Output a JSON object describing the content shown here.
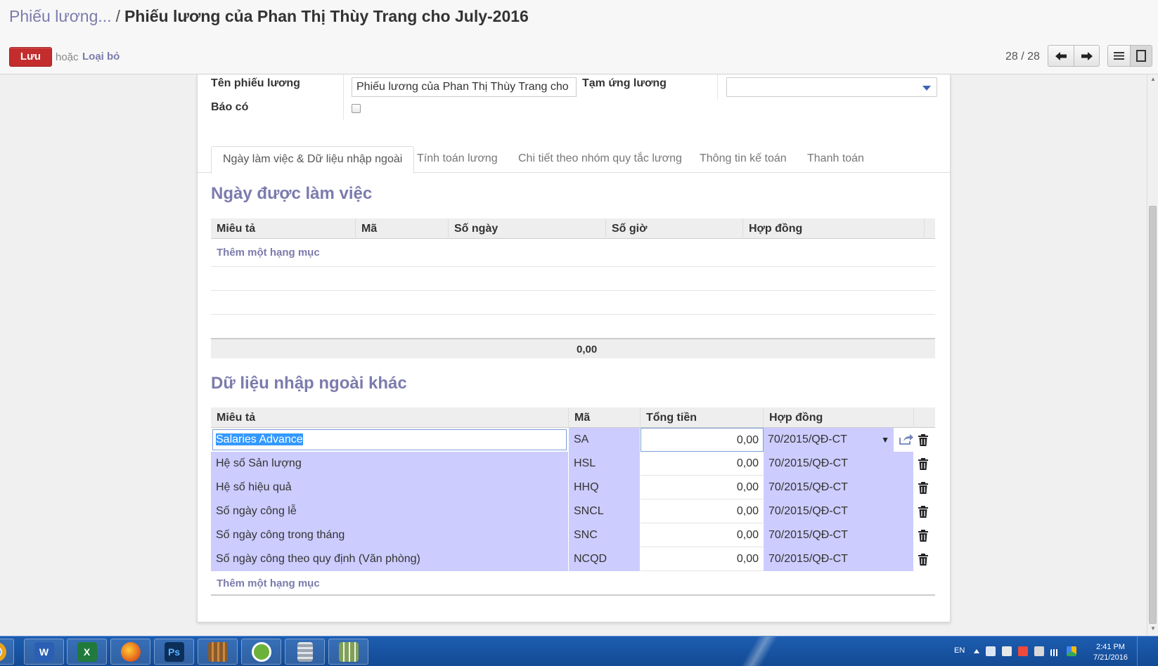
{
  "header": {
    "breadcrumb_parent": "Phiếu lương...",
    "breadcrumb_separator": "/",
    "title": "Phiếu lương của Phan Thị Thùy Trang cho July-2016",
    "save_label": "Lưu",
    "or_label": "hoặc",
    "discard_label": "Loại bỏ",
    "pager": "28 / 28"
  },
  "form": {
    "name_label": "Tên phiếu lương",
    "name_value": "Phiếu lương của Phan Thị Thùy Trang cho",
    "advance_label": "Tạm ứng lương",
    "advance_value": "",
    "credit_note_label": "Báo có"
  },
  "tabs": [
    {
      "label": "Ngày làm việc & Dữ liệu nhập ngoài",
      "active": true
    },
    {
      "label": "Tính toán lương",
      "active": false
    },
    {
      "label": "Chi tiết theo nhóm quy tắc lương",
      "active": false
    },
    {
      "label": "Thông tin kế toán",
      "active": false
    },
    {
      "label": "Thanh toán",
      "active": false
    }
  ],
  "worked_days": {
    "title": "Ngày được làm việc",
    "columns": [
      "Miêu tả",
      "Mã",
      "Số ngày",
      "Số giờ",
      "Hợp đồng"
    ],
    "add_label": "Thêm một hạng mục",
    "total": "0,00"
  },
  "inputs": {
    "title": "Dữ liệu nhập ngoài khác",
    "columns": [
      "Miêu tả",
      "Mã",
      "Tổng tiền",
      "Hợp đồng"
    ],
    "rows": [
      {
        "desc": "Salaries Advance",
        "code": "SA",
        "amount": "0,00",
        "contract": "70/2015/QĐ-CT"
      },
      {
        "desc": "Hệ số Sản lượng",
        "code": "HSL",
        "amount": "0,00",
        "contract": "70/2015/QĐ-CT"
      },
      {
        "desc": "Hệ số hiệu quả",
        "code": "HHQ",
        "amount": "0,00",
        "contract": "70/2015/QĐ-CT"
      },
      {
        "desc": "Số ngày công lễ",
        "code": "SNCL",
        "amount": "0,00",
        "contract": "70/2015/QĐ-CT"
      },
      {
        "desc": "Số ngày công trong tháng",
        "code": "SNC",
        "amount": "0,00",
        "contract": "70/2015/QĐ-CT"
      },
      {
        "desc": "Số ngày công theo quy định (Văn phòng)",
        "code": "NCQD",
        "amount": "0,00",
        "contract": "70/2015/QĐ-CT"
      }
    ],
    "add_label": "Thêm một hạng mục"
  },
  "taskbar": {
    "apps": [
      {
        "icon": "chrome-icon",
        "color": "#e8a41c"
      },
      {
        "icon": "word-icon",
        "label": "W",
        "color": "#2b5fb4"
      },
      {
        "icon": "excel-icon",
        "label": "X",
        "color": "#1f7a3c"
      },
      {
        "icon": "firefox-icon",
        "color": "#e66a1f"
      },
      {
        "icon": "photoshop-icon",
        "label": "Ps",
        "color": "#0c2f5a"
      },
      {
        "icon": "library-icon",
        "color": "#8b5a2b"
      },
      {
        "icon": "greenshot-icon",
        "color": "#6bb13a"
      },
      {
        "icon": "calculator-icon",
        "color": "#9aa4b0"
      },
      {
        "icon": "spreadsheet-app-icon",
        "color": "#7fa05a"
      }
    ],
    "lang": "EN",
    "time": "2:41 PM",
    "date": "7/21/2016"
  },
  "colors": {
    "accent": "#7c7bad",
    "save": "#c42d2d",
    "row_highlight": "#ccccff"
  }
}
